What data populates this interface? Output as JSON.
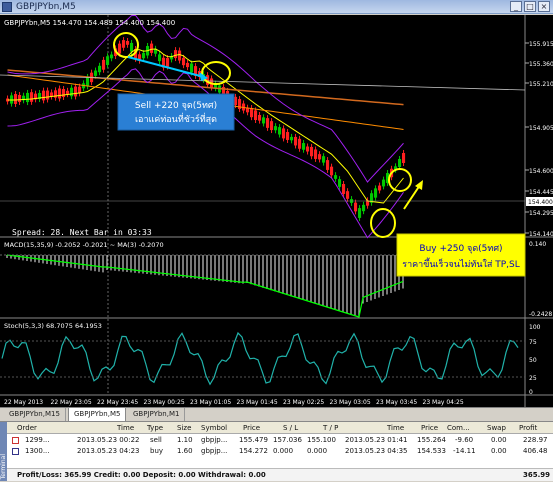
{
  "window": {
    "title": "GBPJPYbn,M5"
  },
  "chart": {
    "header": "GBPJPYbn,M5  154.470 154.489 154.400 154.400",
    "price_ticks": [
      "155.915",
      "155.360",
      "155.210",
      "154.905",
      "154.600",
      "154.445",
      "154.295",
      "154.140"
    ],
    "current_price": "154.400",
    "spread_label": "Spread: 28. Next Bar in 03:33",
    "annotation_sell": {
      "line1": "Sell +220 จุด(5ทศ)",
      "line2": "เอาแค่ท่อนที่ชัวร์ที่สุด"
    },
    "annotation_buy": {
      "line1": "Buy +250 จุด(5ทศ)",
      "line2": "ราคาขึ้นเร็วจนไม่ทันใส่ TP,SL"
    }
  },
  "macd": {
    "label": "MACD(15,35,9) -0.2052 -0.2021 ~ MA(3) -0.2070",
    "ticks": [
      "0.140",
      "-0.2428"
    ]
  },
  "stoch": {
    "label": "Stoch(5,3,3) 68.7075 64.1953",
    "ticks": [
      "100",
      "75",
      "50",
      "25",
      "0"
    ]
  },
  "time_axis": [
    "22 May 2013",
    "22 May 23:05",
    "22 May 23:45",
    "23 May 00:25",
    "23 May 01:05",
    "23 May 01:45",
    "23 May 02:25",
    "23 May 03:05",
    "23 May 03:45",
    "23 May 04:25"
  ],
  "tabs": [
    {
      "label": "GBPJPYbn,M15",
      "active": false
    },
    {
      "label": "GBPJPYbn,M5",
      "active": true
    },
    {
      "label": "GBPJPYbn,M1",
      "active": false
    }
  ],
  "terminal": {
    "side_label": "Terminal",
    "columns": [
      "Order",
      "Time",
      "Type",
      "Size",
      "Symbol",
      "Price",
      "S / L",
      "T / P",
      "Time",
      "Price",
      "Com...",
      "Swap",
      "Profit"
    ],
    "rows": [
      {
        "order": "1299...",
        "time": "2013.05.23 00:22",
        "type": "sell",
        "size": "1.10",
        "symbol": "gbpjp...",
        "price": "155.479",
        "sl": "157.036",
        "tp": "155.100",
        "close_time": "2013.05.23 01:41",
        "close_price": "155.264",
        "commission": "-9.60",
        "swap": "0.00",
        "profit": "228.97"
      },
      {
        "order": "1300...",
        "time": "2013.05.23 04:23",
        "type": "buy",
        "size": "1.60",
        "symbol": "gbpjp...",
        "price": "154.272",
        "sl": "0.000",
        "tp": "0.000",
        "close_time": "2013.05.23 04:35",
        "close_price": "154.533",
        "commission": "-14.11",
        "swap": "0.00",
        "profit": "406.48"
      }
    ],
    "summary": "Profit/Loss: 365.99  Credit: 0.00  Deposit: 0.00  Withdrawal: 0.00",
    "summary_total": "365.99"
  },
  "colors": {
    "bull": "#00c800",
    "bear": "#ff2020",
    "annotation_box": "#2a7fd4",
    "annotation_circle": "#ffff00",
    "macd_line": "#00ff00",
    "stoch_line": "#20b2aa"
  }
}
